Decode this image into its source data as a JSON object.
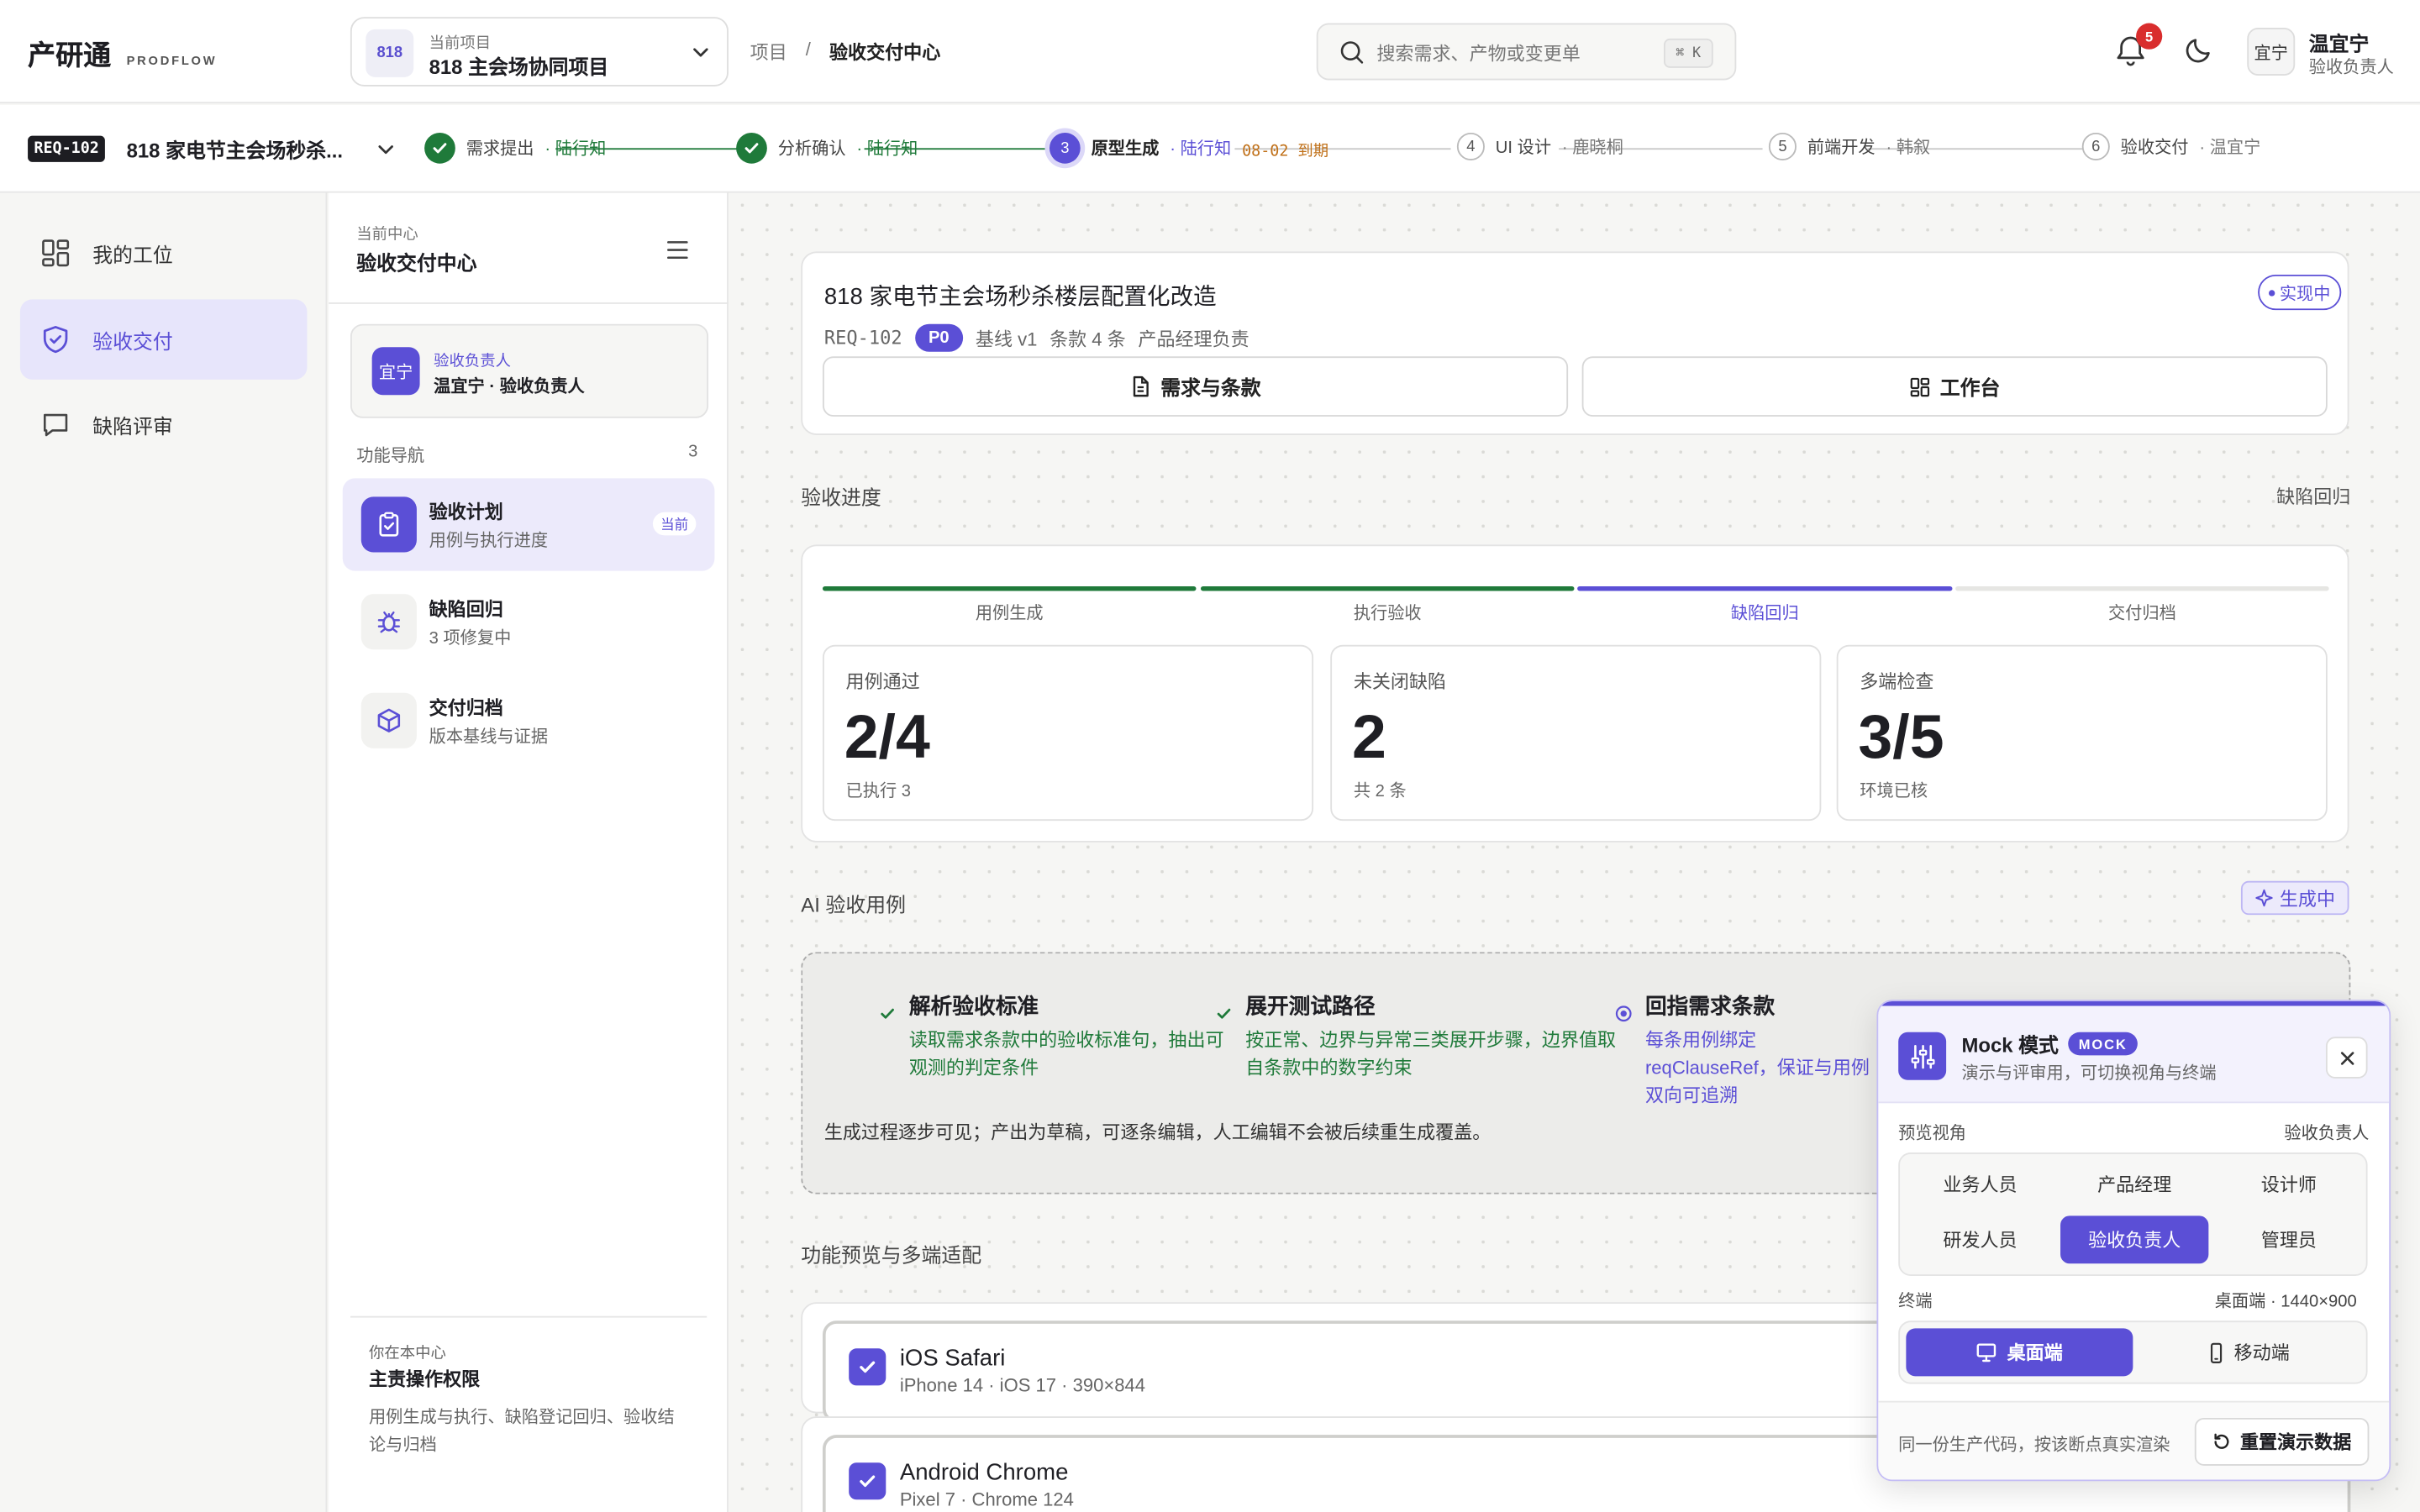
{
  "app": {
    "name": "产研通",
    "sub": "PRODFLOW"
  },
  "project": {
    "badge": "818",
    "label": "当前项目",
    "name": "818 主会场协同项目"
  },
  "breadcrumb": {
    "root": "项目",
    "sep": "/",
    "current": "验收交付中心"
  },
  "search": {
    "placeholder": "搜索需求、产物或变更单",
    "shortcut": "⌘ K"
  },
  "notifications": {
    "count": "5"
  },
  "user": {
    "avatar": "宜宁",
    "name": "温宜宁",
    "role": "验收负责人"
  },
  "requirement": {
    "id": "REQ-102",
    "short_title": "818 家电节主会场秒杀...",
    "title": "818 家电节主会场秒杀楼层配置化改造",
    "status": "实现中",
    "priority": "P0",
    "baseline": "基线 v1",
    "clauses": "条款 4 条",
    "owner": "产品经理负责",
    "btn_clauses": "需求与条款",
    "btn_workbench": "工作台"
  },
  "steps": [
    {
      "num": "",
      "name": "需求提出",
      "owner": "· 陆行知",
      "state": "done",
      "due": ""
    },
    {
      "num": "",
      "name": "分析确认",
      "owner": "· 陆行知",
      "state": "done",
      "due": ""
    },
    {
      "num": "3",
      "name": "原型生成",
      "owner": "· 陆行知",
      "state": "current",
      "due": "08-02 到期"
    },
    {
      "num": "4",
      "name": "UI 设计",
      "owner": "· 鹿晓桐",
      "state": "todo",
      "due": ""
    },
    {
      "num": "5",
      "name": "前端开发",
      "owner": "· 韩叙",
      "state": "todo",
      "due": ""
    },
    {
      "num": "6",
      "name": "验收交付",
      "owner": "· 温宜宁",
      "state": "todo",
      "due": ""
    }
  ],
  "leftnav": {
    "items": [
      {
        "label": "我的工位",
        "icon": "grid-icon"
      },
      {
        "label": "验收交付",
        "icon": "shield-check-icon"
      },
      {
        "label": "缺陷评审",
        "icon": "chat-bubble-icon"
      }
    ]
  },
  "center": {
    "label": "当前中心",
    "title": "验收交付中心",
    "owner_avatar": "宜宁",
    "owner_label": "验收负责人",
    "owner_value": "温宜宁 · 验收负责人",
    "nav_label": "功能导航",
    "nav_count": "3",
    "functions": [
      {
        "title": "验收计划",
        "sub": "用例与执行进度",
        "badge": "当前"
      },
      {
        "title": "缺陷回归",
        "sub": "3 项修复中",
        "badge": ""
      },
      {
        "title": "交付归档",
        "sub": "版本基线与证据",
        "badge": ""
      }
    ],
    "footer_label": "你在本中心",
    "footer_title": "主责操作权限",
    "footer_desc": "用例生成与执行、缺陷登记回归、验收结论与归档"
  },
  "progress": {
    "title": "验收进度",
    "right_link": "缺陷回归",
    "stages": [
      {
        "label": "用例生成",
        "state": "done"
      },
      {
        "label": "执行验收",
        "state": "done"
      },
      {
        "label": "缺陷回归",
        "state": "current"
      },
      {
        "label": "交付归档",
        "state": "todo"
      }
    ],
    "stats": [
      {
        "label": "用例通过",
        "value": "2/4",
        "sub": "已执行 3"
      },
      {
        "label": "未关闭缺陷",
        "value": "2",
        "sub": "共 2 条"
      },
      {
        "label": "多端检查",
        "value": "3/5",
        "sub": "环境已核"
      }
    ]
  },
  "ai": {
    "title": "AI 验收用例",
    "badge": "生成中",
    "steps": [
      {
        "title": "解析验收标准",
        "desc": "读取需求条款中的验收标准句，抽出可观测的判定条件",
        "state": "done"
      },
      {
        "title": "展开测试路径",
        "desc": "按正常、边界与异常三类展开步骤，边界值取自条款中的数字约束",
        "state": "done"
      },
      {
        "title": "回指需求条款",
        "desc": "每条用例绑定 reqClauseRef，保证与用例双向可追溯",
        "state": "current"
      }
    ],
    "note": "生成过程逐步可见；产出为草稿，可逐条编辑，人工编辑不会被后续重生成覆盖。"
  },
  "preview": {
    "title": "功能预览与多端适配",
    "devices": [
      {
        "name": "iOS Safari",
        "spec": "iPhone 14 · iOS 17 · 390×844"
      },
      {
        "name": "Android Chrome",
        "spec": "Pixel 7 · Chrome 124"
      }
    ]
  },
  "mock": {
    "title": "Mock 模式",
    "tag": "MOCK",
    "subtitle": "演示与评审用，可切换视角与终端",
    "view_label": "预览视角",
    "view_current": "验收负责人",
    "roles": [
      "业务人员",
      "产品经理",
      "设计师",
      "研发人员",
      "验收负责人",
      "管理员"
    ],
    "selected_role": "验收负责人",
    "terminal_label": "终端",
    "terminal_current": "桌面端 · 1440×900",
    "terminals": [
      "桌面端",
      "移动端"
    ],
    "footer_note": "同一份生产代码，按该断点真实渲染",
    "reset": "重置演示数据"
  },
  "colors": {
    "accent": "#5b4fd6",
    "done": "#1f7a3a",
    "due": "#c07018",
    "danger": "#d92d2d"
  }
}
